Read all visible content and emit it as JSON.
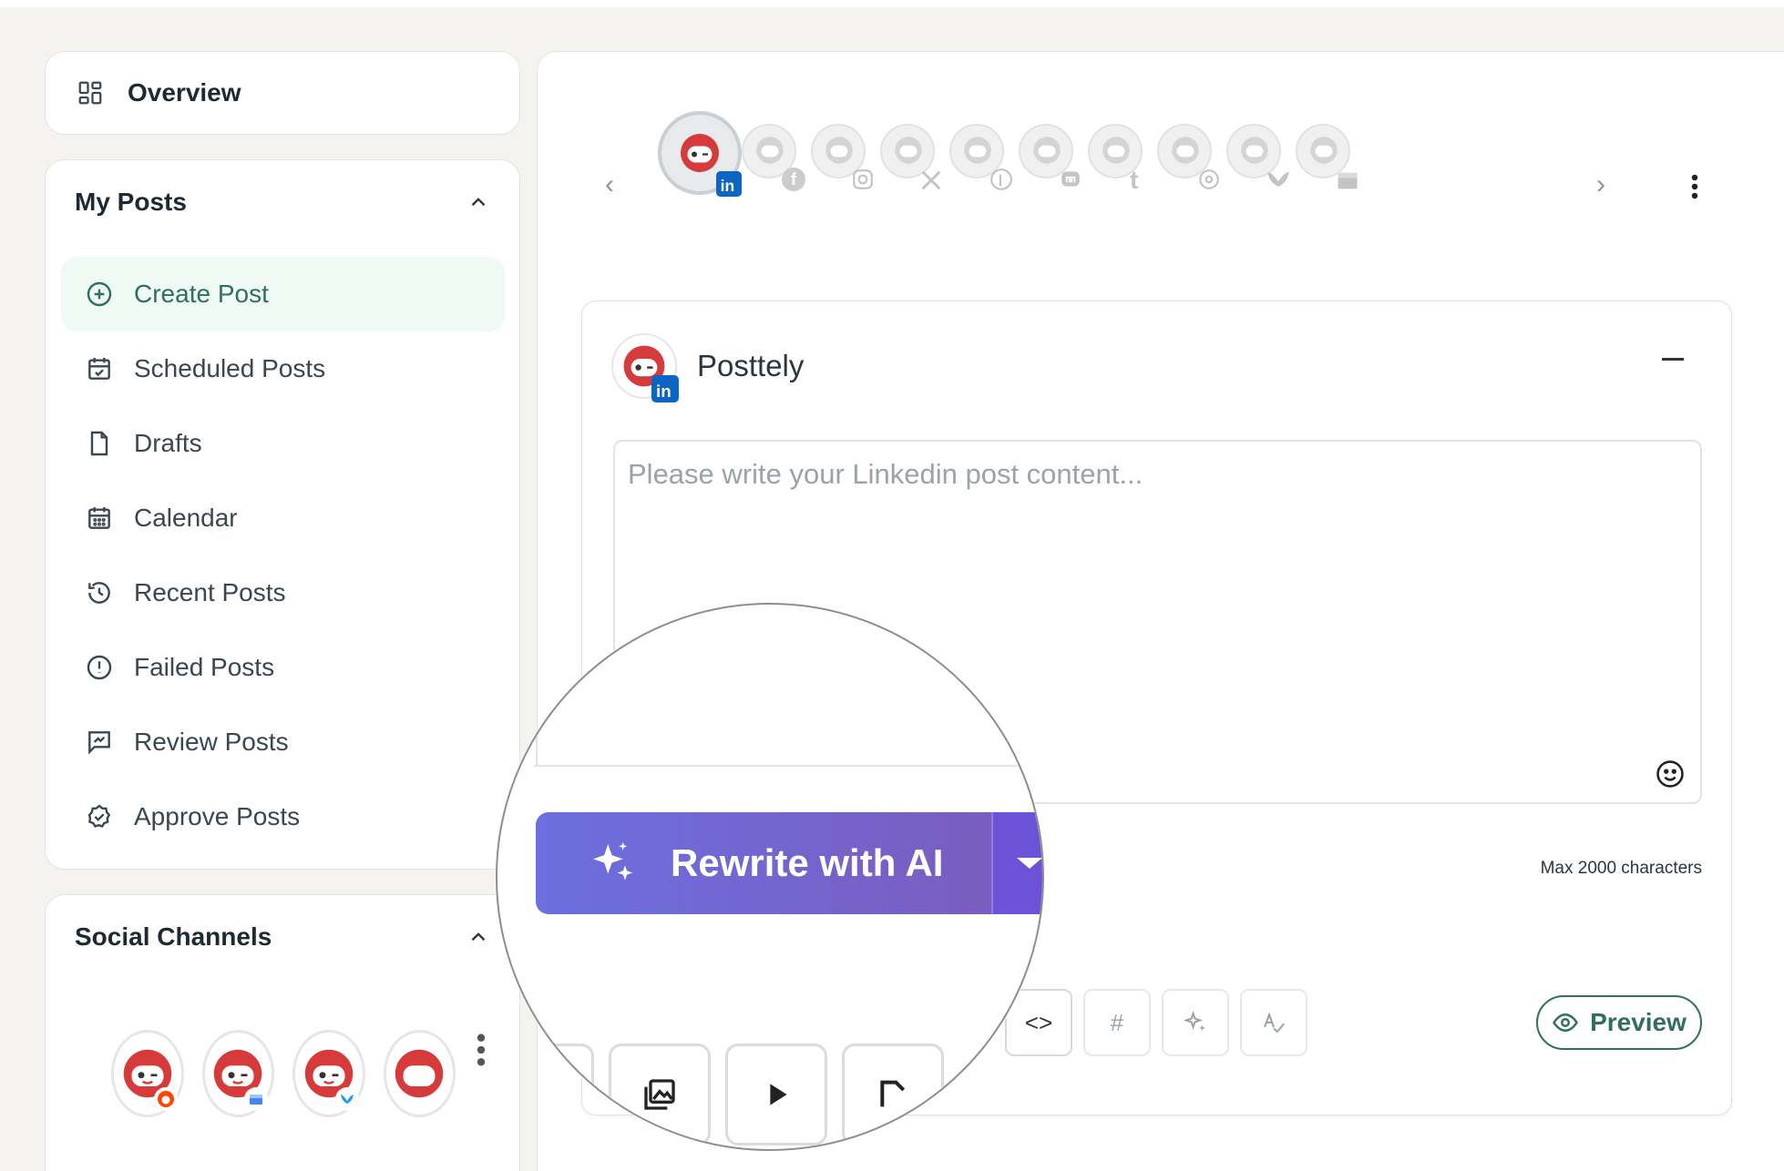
{
  "sidebar": {
    "overview": "Overview",
    "my_posts": {
      "title": "My Posts",
      "items": [
        {
          "label": "Create Post",
          "icon": "plus-circle-icon",
          "active": true
        },
        {
          "label": "Scheduled Posts",
          "icon": "calendar-check-icon"
        },
        {
          "label": "Drafts",
          "icon": "document-icon"
        },
        {
          "label": "Calendar",
          "icon": "calendar-icon"
        },
        {
          "label": "Recent Posts",
          "icon": "history-icon"
        },
        {
          "label": "Failed Posts",
          "icon": "alert-circle-icon"
        },
        {
          "label": "Review Posts",
          "icon": "review-icon"
        },
        {
          "label": "Approve Posts",
          "icon": "badge-check-icon"
        }
      ]
    },
    "social_channels": {
      "title": "Social Channels"
    }
  },
  "channels": {
    "networks": [
      "linkedin",
      "facebook",
      "instagram",
      "x",
      "pinterest",
      "mastodon",
      "tumblr",
      "threads",
      "bluesky",
      "google-business"
    ]
  },
  "composer": {
    "account_name": "Posttely",
    "placeholder": "Please write your Linkedin post content...",
    "max_chars": "Max 2000 characters",
    "ai_button": "Rewrite with AI",
    "preview": "Preview",
    "toolbar": [
      "<>",
      "#"
    ]
  },
  "colors": {
    "accent_green": "#2f6f5f",
    "active_bg": "#eefaf3",
    "ai_gradient_start": "#6c6fe0",
    "ai_gradient_end": "#7a5dbf",
    "brand_red": "#d63a3a",
    "linkedin_blue": "#0a66c2"
  }
}
